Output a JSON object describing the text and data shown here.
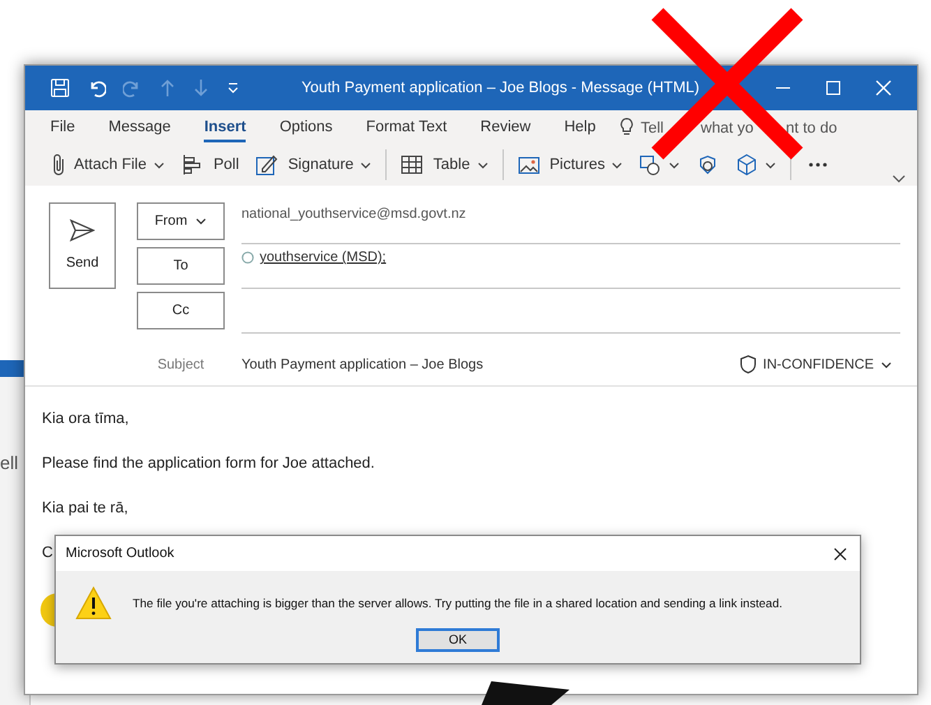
{
  "background_window": {
    "text": "ell"
  },
  "window": {
    "title": "Youth Payment application – Joe Blogs  -  Message (HTML)"
  },
  "menu": [
    {
      "label": "File",
      "selected": false
    },
    {
      "label": "Message",
      "selected": false
    },
    {
      "label": "Insert",
      "selected": true
    },
    {
      "label": "Options",
      "selected": false
    },
    {
      "label": "Format Text",
      "selected": false
    },
    {
      "label": "Review",
      "selected": false
    },
    {
      "label": "Help",
      "selected": false
    }
  ],
  "tell_me": {
    "visible_parts": [
      "Tell",
      "what yo",
      "nt to do"
    ]
  },
  "toolbar": [
    {
      "kind": "attach",
      "label": "Attach File"
    },
    {
      "kind": "poll",
      "label": "Poll"
    },
    {
      "kind": "signature",
      "label": "Signature"
    },
    {
      "kind": "table",
      "label": "Table"
    },
    {
      "kind": "pictures",
      "label": "Pictures"
    },
    {
      "kind": "shapes"
    },
    {
      "kind": "icons"
    },
    {
      "kind": "models"
    },
    {
      "kind": "more"
    }
  ],
  "send": {
    "label": "Send"
  },
  "from": {
    "label": "From",
    "value": "national_youthservice@msd.govt.nz"
  },
  "to": {
    "label": "To",
    "recipient": "youthservice (MSD);"
  },
  "cc": {
    "label": "Cc"
  },
  "subject": {
    "label": "Subject",
    "value": "Youth Payment application – Joe Blogs",
    "sensitivity": "IN-CONFIDENCE"
  },
  "body": [
    "Kia ora tīma,",
    "Please find the application form for Joe attached.",
    "Kia pai te rā,",
    "C"
  ],
  "dialog": {
    "title": "Microsoft Outlook",
    "message": "The file you're attaching is bigger than the server allows. Try putting the file in a shared location and sending a link instead.",
    "button": "OK"
  }
}
